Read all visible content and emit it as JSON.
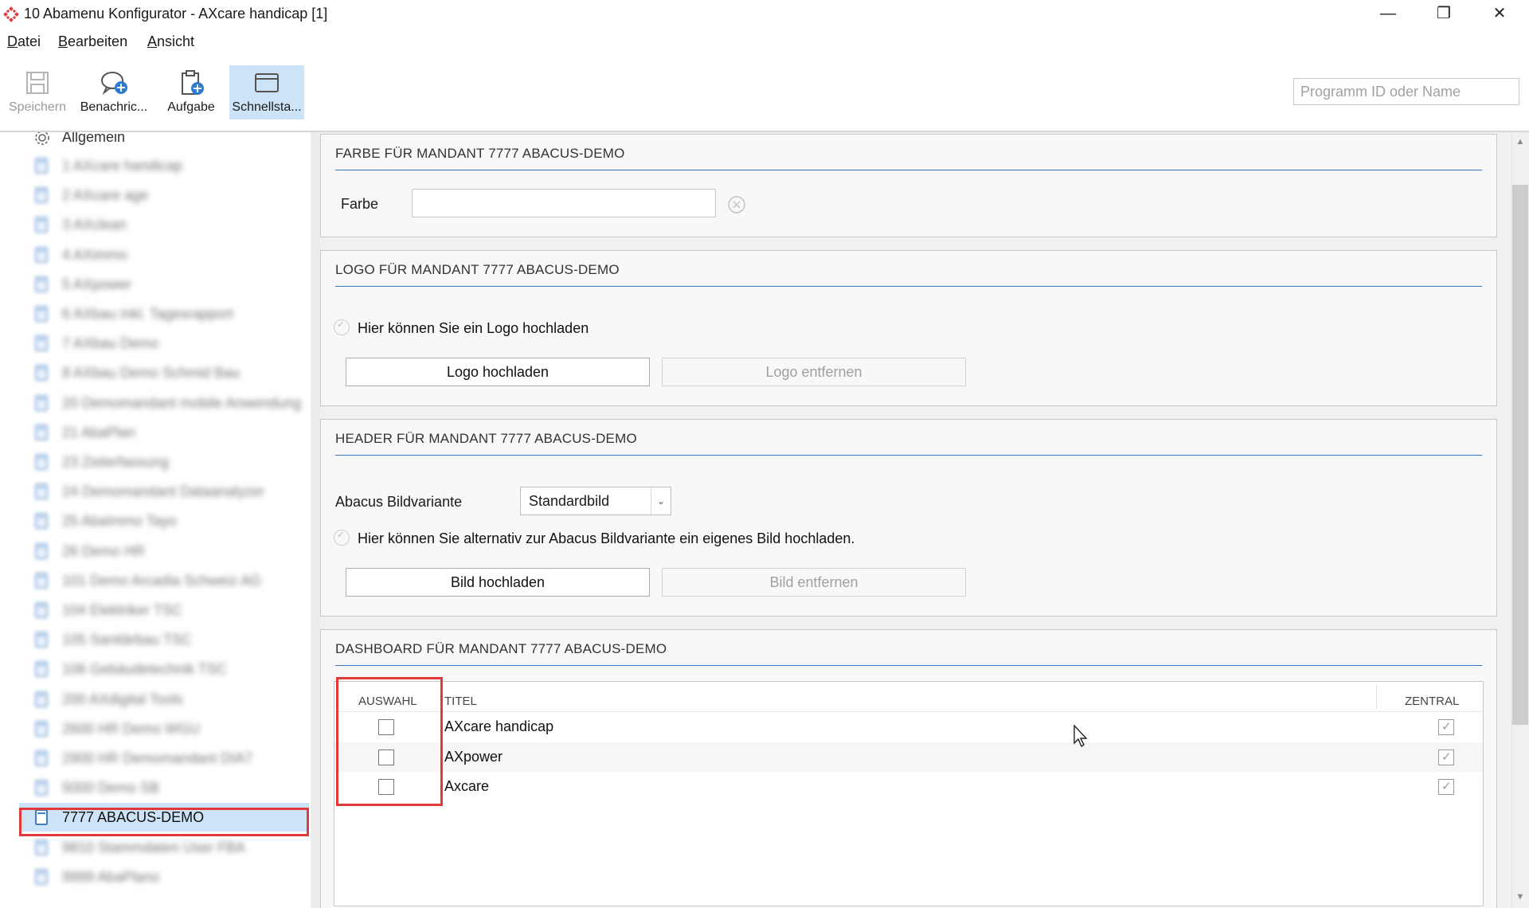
{
  "window": {
    "title": "10 Abamenu Konfigurator - AXcare handicap [1]",
    "minimize": "—",
    "restore": "❐",
    "close": "✕"
  },
  "menu": [
    "Datei",
    "Bearbeiten",
    "Ansicht"
  ],
  "toolbar": {
    "buttons": [
      {
        "label": "Speichern",
        "icon": "save-icon",
        "enabled": false
      },
      {
        "label": "Benachric...",
        "icon": "message-add-icon",
        "enabled": true
      },
      {
        "label": "Aufgabe",
        "icon": "clipboard-add-icon",
        "enabled": true
      },
      {
        "label": "Schnellsta...",
        "icon": "window-icon",
        "enabled": true,
        "active": true
      }
    ],
    "search_placeholder": "Programm ID oder Name"
  },
  "sidebar": {
    "top_item": "Allgemein",
    "items": [
      "1 AXcare handicap",
      "2 AXcare age",
      "3 AXclean",
      "4 AXimmo",
      "5 AXpower",
      "6 AXbau inkl. Tagesrapport",
      "7 AXbau Demo",
      "8 AXbau Demo Schmid Bau",
      "20 Demomandant mobile Anwendung",
      "21 AbaPlan",
      "23 Zeiterfassung",
      "24 Demomandant Dataanalyzer",
      "25 AbaImmo Tayo",
      "26 Demo HR",
      "101 Demo Arcadia Schweiz AG",
      "104 Elektriker TSC",
      "105 Sanitärbau TSC",
      "106 Gebäudetechnik TSC",
      "200 AXdigital Tools",
      "2600 HR Demo WGU",
      "2900 HR Demomandant DIA7",
      "5000 Demo SB",
      "7777 ABACUS-DEMO",
      "9810 Stammdaten User FBA",
      "9999 AbaPlano"
    ],
    "selected_index": 22
  },
  "panels": {
    "farbe": {
      "title": "FARBE FÜR MANDANT 7777 ABACUS-DEMO",
      "label": "Farbe",
      "value": ""
    },
    "logo": {
      "title": "LOGO FÜR MANDANT 7777 ABACUS-DEMO",
      "hint": "Hier können Sie ein Logo hochladen",
      "upload": "Logo hochladen",
      "remove": "Logo entfernen"
    },
    "header": {
      "title": "HEADER FÜR MANDANT 7777 ABACUS-DEMO",
      "variant_label": "Abacus Bildvariante",
      "variant_value": "Standardbild",
      "hint": "Hier können Sie alternativ zur Abacus Bildvariante ein eigenes Bild hochladen.",
      "upload": "Bild hochladen",
      "remove": "Bild entfernen"
    },
    "dashboard": {
      "title": "DASHBOARD FÜR MANDANT 7777 ABACUS-DEMO",
      "columns": [
        "AUSWAHL",
        "TITEL",
        "ZENTRAL"
      ],
      "rows": [
        {
          "auswahl": false,
          "titel": "AXcare handicap",
          "zentral": true
        },
        {
          "auswahl": false,
          "titel": "AXpower",
          "zentral": true
        },
        {
          "auswahl": false,
          "titel": "Axcare",
          "zentral": true
        }
      ]
    }
  },
  "colors": {
    "accent": "#3b78c4",
    "highlight": "#e03a3a",
    "selection": "#cde3f7"
  }
}
